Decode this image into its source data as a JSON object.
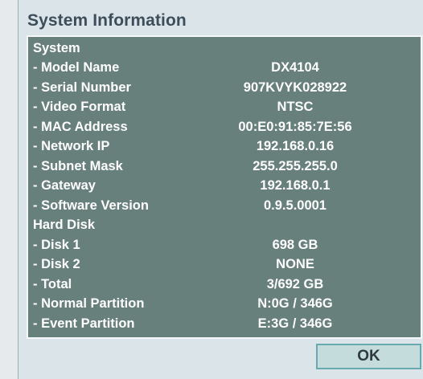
{
  "dialog": {
    "title": "System Information",
    "ok_label": "OK"
  },
  "system": {
    "heading": "System",
    "items": [
      {
        "label": "- Model Name",
        "value": "DX4104"
      },
      {
        "label": "- Serial Number",
        "value": "907KVYK028922"
      },
      {
        "label": "- Video Format",
        "value": "NTSC"
      },
      {
        "label": "- MAC Address",
        "value": "00:E0:91:85:7E:56"
      },
      {
        "label": "- Network IP",
        "value": "192.168.0.16"
      },
      {
        "label": "- Subnet Mask",
        "value": "255.255.255.0"
      },
      {
        "label": "- Gateway",
        "value": "192.168.0.1"
      },
      {
        "label": "- Software Version",
        "value": "0.9.5.0001"
      }
    ]
  },
  "hard_disk": {
    "heading": "Hard Disk",
    "items": [
      {
        "label": "- Disk 1",
        "value": "698 GB"
      },
      {
        "label": "- Disk 2",
        "value": "NONE"
      },
      {
        "label": "- Total",
        "value": "3/692 GB"
      },
      {
        "label": "- Normal Partition",
        "value": "N:0G / 346G"
      },
      {
        "label": "- Event Partition",
        "value": "E:3G / 346G"
      }
    ]
  },
  "colors": {
    "panel_background": "#67807b",
    "dialog_background": "#dbe5e9",
    "button_background": "#c4dcdc",
    "button_border": "#68a9b0",
    "title_text": "#3d4e5a"
  }
}
